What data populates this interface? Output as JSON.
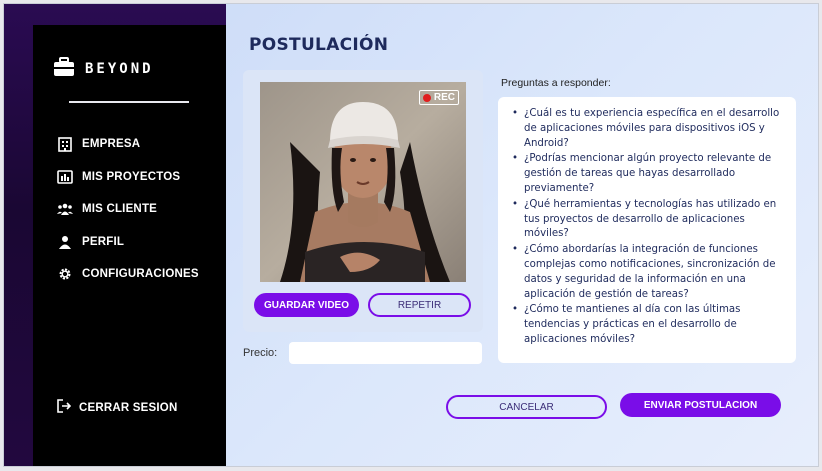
{
  "brand": {
    "name": "BEYOND",
    "icon": "briefcase-icon"
  },
  "nav": {
    "items": [
      {
        "label": "EMPRESA",
        "icon": "building-icon"
      },
      {
        "label": "MIS PROYECTOS",
        "icon": "projects-icon"
      },
      {
        "label": "MIS CLIENTE",
        "icon": "users-group-icon"
      },
      {
        "label": "PERFIL",
        "icon": "user-icon"
      },
      {
        "label": "CONFIGURACIONES",
        "icon": "gear-icon"
      }
    ],
    "logout": {
      "label": "CERRAR SESION",
      "icon": "logout-icon"
    }
  },
  "page": {
    "title": "POSTULACIÓN"
  },
  "video": {
    "rec_label": "REC",
    "save_label": "GUARDAR VIDEO",
    "retry_label": "REPETIR"
  },
  "price": {
    "label": "Precio:",
    "value": "",
    "placeholder": ""
  },
  "questions": {
    "title": "Preguntas a responder:",
    "items": [
      "¿Cuál es tu experiencia específica en el desarrollo de aplicaciones móviles para dispositivos iOS y Android?",
      "¿Podrías mencionar algún proyecto relevante de gestión de tareas que hayas desarrollado previamente?",
      "¿Qué herramientas y tecnologías has utilizado en tus proyectos de desarrollo de aplicaciones móviles?",
      "¿Cómo abordarías la integración de funciones complejas como notificaciones, sincronización de datos y seguridad de la información en una aplicación de gestión de tareas?",
      "¿Cómo te mantienes al día con las últimas tendencias y prácticas en el desarrollo de aplicaciones móviles?"
    ]
  },
  "actions": {
    "cancel_label": "CANCELAR",
    "submit_label": "ENVIAR POSTULACION"
  },
  "colors": {
    "accent": "#7a0de8",
    "sidebar": "#000000",
    "title": "#1e2a5c"
  }
}
